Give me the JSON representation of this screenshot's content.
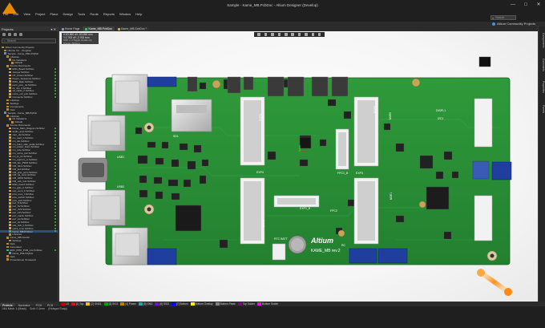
{
  "window": {
    "title": "Sample - Kame_MB.PcbDoc - Altium Designer (Develop)",
    "controls": [
      "—",
      "□",
      "✕"
    ]
  },
  "menu": [
    "File",
    "Edit",
    "View",
    "Project",
    "Place",
    "Design",
    "Tools",
    "Route",
    "Reports",
    "Window",
    "Help"
  ],
  "search": {
    "placeholder": "Search"
  },
  "community": "Altium Community Projects",
  "projects_panel": {
    "title": "Projects",
    "search_placeholder": "Search",
    "tree": [
      "Altium Community Projects",
      "Ubuntu Inc. - Kingston",
      "Sample - Kame_PMU.PrjPcb",
      "Libraries",
      "No Variations",
      "Default",
      "Source Documents",
      "ESD_Board.SchDoc",
      "Jumper.SchDoc",
      "OT_Power.SchDoc",
      "Power_Sequence.SchDoc",
      "PMU_Main.SchDoc",
      "pwm_pcm_rst.SchDoc",
      "rtc_dio_2.SchDoc",
      "sd_cards_h.SchDoc",
      "nvme_m2_pcb.SchDoc",
      "Connector.SchDoc",
      "Libraries",
      "Settings",
      "Components",
      "Nets",
      "Sample - Kame_MB.PrjPcb",
      "Libraries",
      "No Variations",
      "Default",
      "Source Documents",
      "Kame_Main_Diagram.SchDoc",
      "audio_amp.SchDoc",
      "cam_dsi.SchDoc",
      "cm_card_h.SchDoc",
      "cm_dio.SchDoc",
      "cm_hdmi_sdio_audio.SchDoc",
      "cm_power_bram.SchDoc",
      "cm_pcie.SchDoc",
      "cm_nvme_pwr.SchDoc",
      "cm_bt_rtc.SchDoc",
      "cm_eeprom_io.SchDoc",
      "CM_fan_PWM.SchDoc",
      "CM_hdmi.SchDoc",
      "CM_led.SchDoc",
      "CM_pcie_pmic.SchDoc",
      "CM_rpi_conn.SchDoc",
      "CM_SDIO.SchDoc",
      "CM_usb_hub.SchDoc",
      "ESD_board.SchDoc",
      "cm_gpio_h.SchDoc",
      "exp_conn_h.SchDoc",
      "pcie_mux_r.SchDoc",
      "pcie_switch.SchDoc",
      "pcie_sw2.SchDoc",
      "pwr_ff.SchDoc",
      "pwr_5V.SchDoc",
      "pwr_3V3.SchDoc",
      "pwr_12V.SchDoc",
      "pwr_mainL.SchDoc",
      "pwr_sw.SchDoc",
      "pwr_vtt.SchDoc",
      "usb_hub_h.SchDoc",
      "usb3_conn.SchDoc",
      "Kame_MB.PcbDoc",
      "Libraries",
      "Kame_MB.OutJob",
      "Settings",
      "Nets",
      "Generated",
      "ERC_PMU_PCB_msr.PcbDoc",
      "Kame_PMU.PrjPcb",
      "Nets",
      "ProjectGroup (Unsaved)"
    ],
    "selected_index": 59,
    "tabs": [
      "Projects",
      "Navigator",
      "PCB",
      "PCB Filter"
    ],
    "active_tab": "Projects"
  },
  "doc_tabs": [
    "Home Page",
    "Kame_MB.PcbDoc",
    "Kame_MB.SchDoc *"
  ],
  "active_doc_tab": 1,
  "coords": {
    "line1": "X:83.860  dX:-83.860  mm",
    "line2": "Y:2.763   dY:-2.763  mm",
    "hint": "Shift + H Toggle Heads-Up Display  Shift+G"
  },
  "pcb": {
    "silk": {
      "logo": "Altium",
      "board_name": "KAME_MB rev.2",
      "labels": [
        "EXP4",
        "EXP3",
        "EXP1_B",
        "FPC1_B",
        "FPC2",
        "RTC BATT",
        "M2E0",
        "M2E1",
        "EXP0",
        "EXP5",
        "EXP2",
        "SD1",
        "USB1",
        "USB2",
        "DISPL1",
        "I2C1",
        "RC"
      ]
    }
  },
  "right_tabs": [
    "Components",
    "Comments",
    "Properties",
    "Panels"
  ],
  "layers": [
    {
      "name": "LS",
      "color": "#c00000"
    },
    {
      "name": "[1] Top",
      "color": "#ff0000"
    },
    {
      "name": "[2] GND1",
      "color": "#ffbf00"
    },
    {
      "name": "[3] SIG1",
      "color": "#00a000"
    },
    {
      "name": "[4] Power",
      "color": "#c08000"
    },
    {
      "name": "[5] GND",
      "color": "#00b0b0"
    },
    {
      "name": "[6] SIG2",
      "color": "#8000ff"
    },
    {
      "name": "[7] Bottom",
      "color": "#0000ff"
    },
    {
      "name": "Bottom Overlay",
      "color": "#ffff00"
    },
    {
      "name": "Bottom Paste",
      "color": "#808080"
    },
    {
      "name": "Top Solder",
      "color": "#800080"
    },
    {
      "name": "Bottom Solder",
      "color": "#ff00ff"
    }
  ],
  "status": [
    "1/64 Mech 1 (Mask)",
    "Grid: 0.1mm",
    "(Hotspot Snap)"
  ]
}
